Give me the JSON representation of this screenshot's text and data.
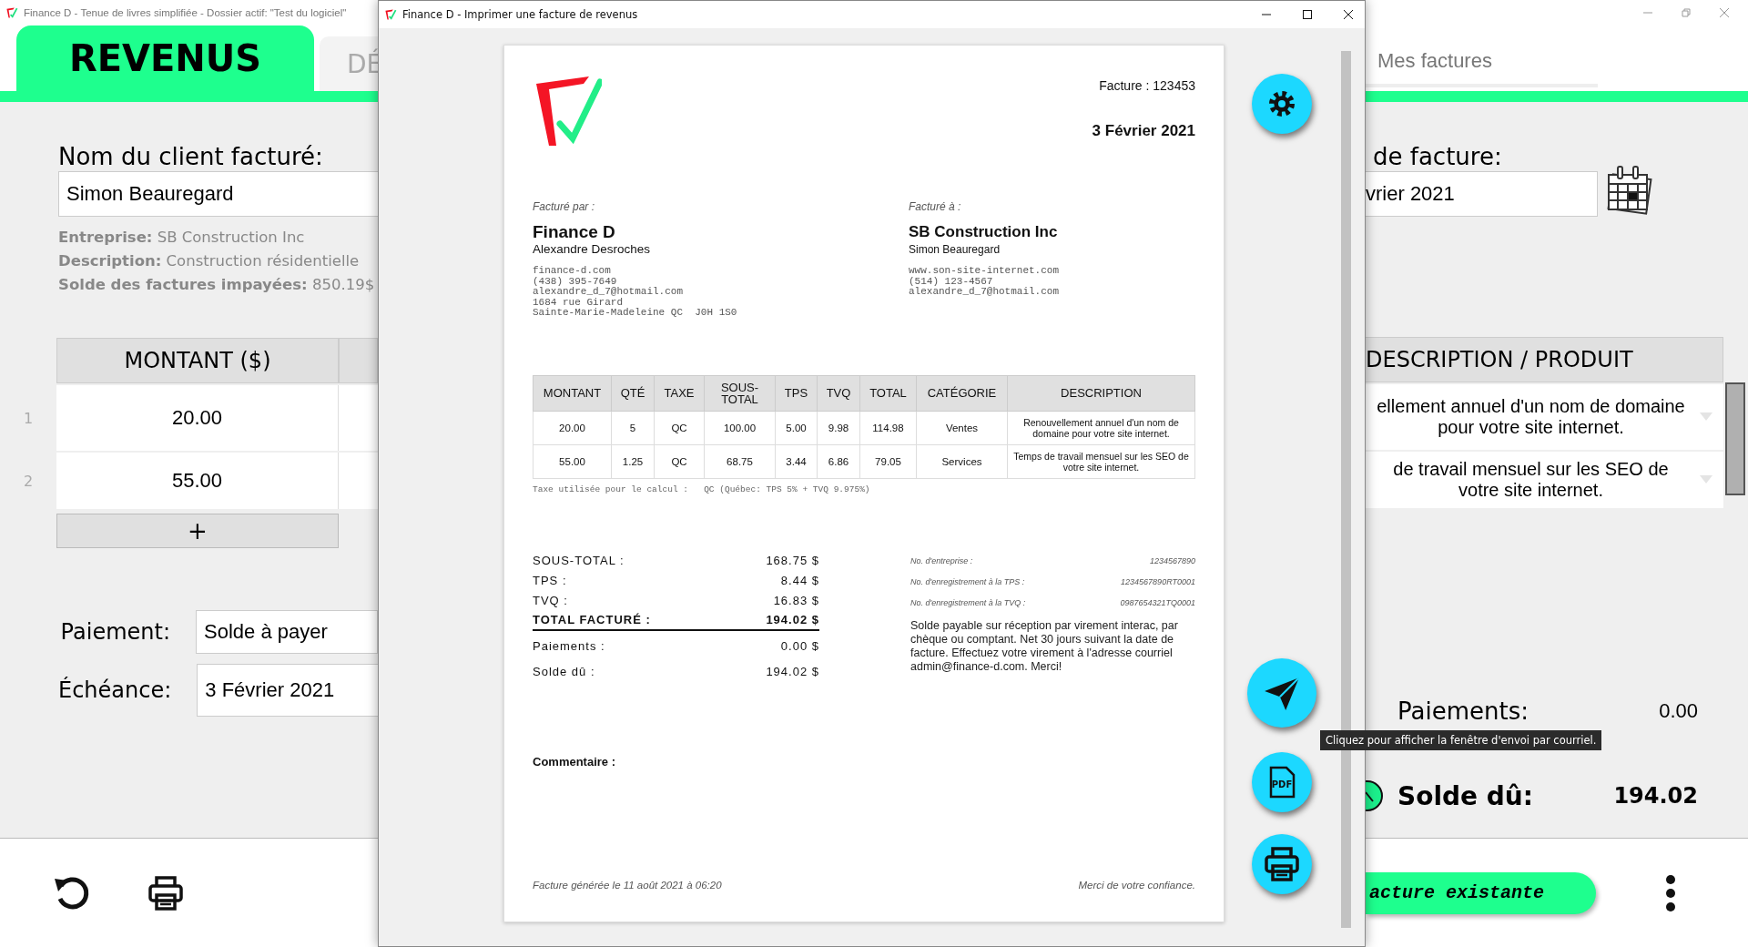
{
  "app_window": {
    "title": "Finance D - Tenue de livres simplifiée - Dossier actif: \"Test du logiciel\""
  },
  "tabs": [
    {
      "label": "REVENUS",
      "selected": true
    },
    {
      "label": "DÉ",
      "selected": false
    }
  ],
  "right_tab": {
    "label": "Mes factures",
    "selected": false
  },
  "client": {
    "label": "Nom du client facturé:",
    "value": "Simon Beauregard",
    "details": [
      {
        "label": "Entreprise:",
        "value": "SB Construction Inc"
      },
      {
        "label": "Description:",
        "value": "Construction résidentielle"
      },
      {
        "label": "Solde des factures impayées:",
        "value": "850.19$"
      }
    ]
  },
  "date_field": {
    "label": "de facture:",
    "value": "vrier 2021"
  },
  "lines_table": {
    "columns": [
      "MONTANT ($)",
      "DESCRIPTION / PRODUIT"
    ],
    "add_label": "+",
    "rows": [
      {
        "number": "1",
        "amount": "20.00",
        "description": [
          "ellement annuel d'un nom de domaine",
          "pour votre site internet."
        ]
      },
      {
        "number": "2",
        "amount": "55.00",
        "description": [
          "de travail mensuel sur les SEO de",
          "votre site internet."
        ]
      }
    ]
  },
  "payment": {
    "label": "Paiement:",
    "value": "Solde à payer"
  },
  "due": {
    "label": "Échéance:",
    "value": "3 Février 2021"
  },
  "summary": {
    "payments_label": "Paiements:",
    "payments_value": "0.00",
    "balance_label": "Solde dû:",
    "balance_value": "194.02"
  },
  "existing_invoice_button": "acture existante",
  "dialog": {
    "title": "Finance D - Imprimer une facture de revenus",
    "tooltip": "Cliquez pour afficher la fenêtre d'envoi par courriel.",
    "pdf_label": "PDF"
  },
  "invoice": {
    "number": "Facture : 123453",
    "date": "3 Février 2021",
    "from": {
      "caption": "Facturé par :",
      "name": "Finance D",
      "contact": "Alexandre Desroches",
      "lines": [
        "finance-d.com",
        "(438) 395-7649",
        "alexandre_d_7@hotmail.com",
        "1684 rue Girard",
        "Sainte-Marie-Madeleine QC  J0H 1S0"
      ]
    },
    "to": {
      "caption": "Facturé à :",
      "name": "SB Construction Inc",
      "contact": "Simon Beauregard",
      "lines": [
        "www.son-site-internet.com",
        "(514) 123-4567",
        "alexandre_d_7@hotmail.com"
      ]
    },
    "table": {
      "columns": [
        "MONTANT",
        "QTÉ",
        "TAXE",
        "SOUS-TOTAL",
        "TPS",
        "TVQ",
        "TOTAL",
        "CATÉGORIE",
        "DESCRIPTION"
      ],
      "rows": [
        [
          "20.00",
          "5",
          "QC",
          "100.00",
          "5.00",
          "9.98",
          "114.98",
          "Ventes",
          "Renouvellement annuel d'un nom de domaine pour votre site internet."
        ],
        [
          "55.00",
          "1.25",
          "QC",
          "68.75",
          "3.44",
          "6.86",
          "79.05",
          "Services",
          "Temps de travail mensuel sur les SEO de votre site internet."
        ]
      ]
    },
    "tax_note": "Taxe utilisée pour le calcul :   QC (Québec: TPS 5% + TVQ 9.975%)",
    "totals": [
      {
        "label": "SOUS-TOTAL :",
        "value": "168.75 $",
        "kind": "line"
      },
      {
        "label": "TPS :",
        "value": "8.44 $",
        "kind": "line"
      },
      {
        "label": "TVQ :",
        "value": "16.83 $",
        "kind": "line"
      },
      {
        "label": "TOTAL FACTURÉ :",
        "value": "194.02 $",
        "kind": "total"
      },
      {
        "label": "Paiements :",
        "value": "0.00 $",
        "kind": "after"
      },
      {
        "label": "Solde dû :",
        "value": "194.02 $",
        "kind": "after"
      }
    ],
    "registrations": [
      {
        "label": "No. d'entreprise :",
        "value": "1234567890"
      },
      {
        "label": "No. d'enregistrement à la TPS :",
        "value": "1234567890RT0001"
      },
      {
        "label": "No. d'enregistrement à la TVQ :",
        "value": "0987654321TQ0001"
      }
    ],
    "terms": "Solde payable sur réception par virement interac, par chèque ou comptant. Net 30 jours suivant la date de facture.  Effectuez votre virement à l'adresse courriel admin@finance-d.com. Merci!",
    "comment_label": "Commentaire :",
    "generated": "Facture générée le 11 août 2021 à 06:20",
    "thanks": "Merci de votre confiance."
  }
}
